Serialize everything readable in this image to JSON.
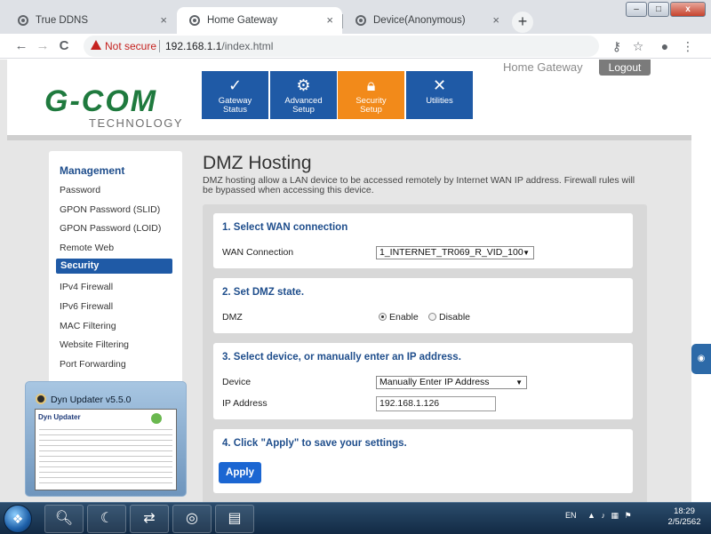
{
  "browser": {
    "tabs": [
      {
        "label": "True DDNS",
        "close": "×"
      },
      {
        "label": "Home Gateway",
        "close": "×"
      },
      {
        "label": "Device(Anonymous)",
        "close": "×"
      }
    ],
    "new_tab": "+",
    "window_buttons": {
      "minimize": "–",
      "maximize": "□",
      "close": "x"
    },
    "nav": {
      "back": "←",
      "forward": "→",
      "reload": "C"
    },
    "security_label": "Not secure",
    "url_host": "192.168.1.1",
    "url_path": "/index.html"
  },
  "header": {
    "brand": "G-COM",
    "brand_sub": "TECHNOLOGY",
    "app_title": "Home Gateway",
    "logout": "Logout",
    "nav": [
      {
        "label1": "Gateway",
        "label2": "Status"
      },
      {
        "label1": "Advanced",
        "label2": "Setup"
      },
      {
        "label1": "Security",
        "label2": "Setup"
      },
      {
        "label1": "Utilities",
        "label2": ""
      }
    ]
  },
  "sidebar": {
    "title": "Management",
    "items": [
      "Password",
      "GPON Password (SLID)",
      "GPON Password (LOID)",
      "Remote Web"
    ],
    "section": "Security",
    "section_items": [
      "IPv4 Firewall",
      "IPv6 Firewall",
      "MAC Filtering",
      "Website Filtering",
      "Port Forwarding"
    ]
  },
  "main": {
    "title": "DMZ Hosting",
    "description": "DMZ hosting allow a LAN device to be accessed remotely by Internet WAN IP address. Firewall rules will be bypassed when accessing this device.",
    "sections": [
      {
        "title": "1. Select WAN connection",
        "label": "WAN Connection",
        "value": "1_INTERNET_TR069_R_VID_100"
      },
      {
        "title": "2. Set DMZ state.",
        "label": "DMZ",
        "options": [
          "Enable",
          "Disable"
        ],
        "selected": "Enable"
      },
      {
        "title": "3. Select device, or manually enter an IP address.",
        "device_label": "Device",
        "device_value": "Manually Enter IP Address",
        "ip_label": "IP Address",
        "ip_value": "192.168.1.126"
      },
      {
        "title": "4. Click \"Apply\" to save your settings.",
        "button": "Apply"
      }
    ]
  },
  "thumbnail": {
    "title": "Dyn Updater v5.5.0",
    "logo": "Dyn Updater"
  },
  "taskbar": {
    "language": "EN",
    "time": "18:29",
    "date": "2/5/2562"
  }
}
